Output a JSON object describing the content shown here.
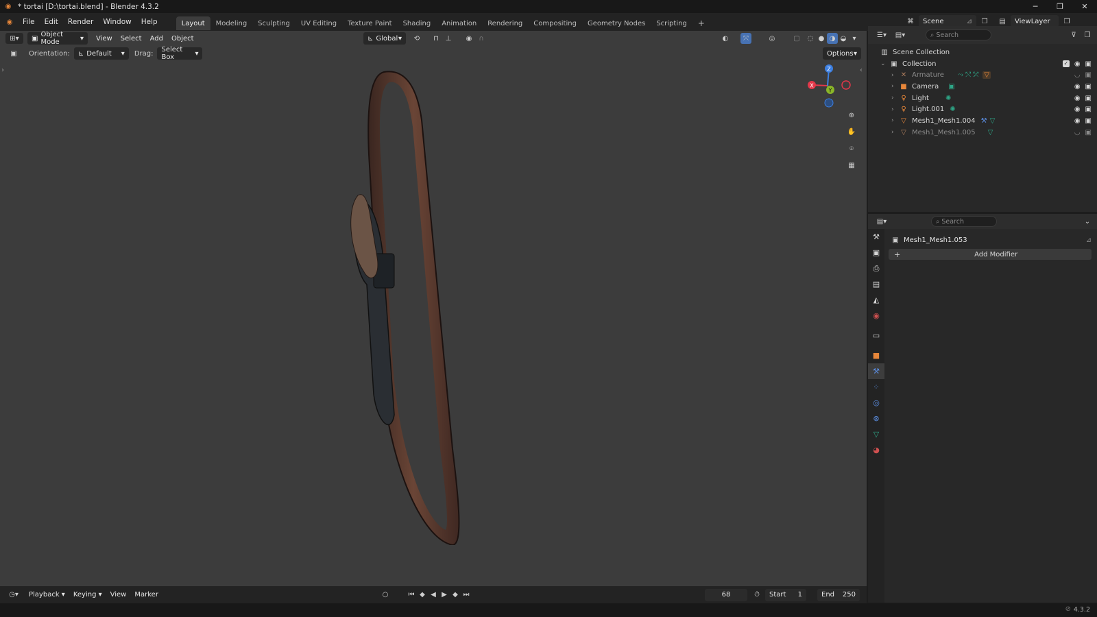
{
  "window": {
    "title": "* tortai [D:\\tortai.blend] - Blender 4.3.2",
    "minimize": "─",
    "maximize": "❐",
    "close": "✕"
  },
  "menu": [
    "File",
    "Edit",
    "Render",
    "Window",
    "Help"
  ],
  "workspaces": {
    "tabs": [
      "Layout",
      "Modeling",
      "Sculpting",
      "UV Editing",
      "Texture Paint",
      "Shading",
      "Animation",
      "Rendering",
      "Compositing",
      "Geometry Nodes",
      "Scripting"
    ],
    "active": "Layout",
    "add": "+"
  },
  "scene": {
    "name": "Scene",
    "view_layer": "ViewLayer"
  },
  "viewport": {
    "mode": "Object Mode",
    "menus": [
      "View",
      "Select",
      "Add",
      "Object"
    ],
    "transform_orientation": "Global",
    "tool": {
      "orientation_label": "Orientation:",
      "orientation_value": "Default",
      "drag_label": "Drag:",
      "drag_value": "Select Box",
      "options": "Options"
    },
    "gizmo": {
      "x": "X",
      "y": "Y",
      "z": "Z"
    }
  },
  "timeline": {
    "menus": [
      "Playback",
      "Keying",
      "View",
      "Marker"
    ],
    "current_frame": "68",
    "start_label": "Start",
    "start": "1",
    "end_label": "End",
    "end": "250"
  },
  "outliner": {
    "search_placeholder": "Search",
    "scene_collection": "Scene Collection",
    "collection": "Collection",
    "items": [
      {
        "name": "Armature",
        "icon": "armature-icon",
        "dim": true
      },
      {
        "name": "Camera",
        "icon": "camera-icon",
        "dim": false
      },
      {
        "name": "Light",
        "icon": "light-icon",
        "dim": false
      },
      {
        "name": "Light.001",
        "icon": "light-icon",
        "dim": false
      },
      {
        "name": "Mesh1_Mesh1.004",
        "icon": "mesh-icon",
        "dim": false
      },
      {
        "name": "Mesh1_Mesh1.005",
        "icon": "mesh-icon",
        "dim": true
      }
    ]
  },
  "properties": {
    "search_placeholder": "Search",
    "object_name": "Mesh1_Mesh1.053",
    "add_modifier": "Add Modifier"
  },
  "status": {
    "version": "4.3.2"
  },
  "colors": {
    "accent": "#4772b3",
    "object_orange": "#e6863a",
    "gizmo_x": "#e3384a",
    "gizmo_y": "#8ab628",
    "gizmo_z": "#3d7fe0"
  }
}
